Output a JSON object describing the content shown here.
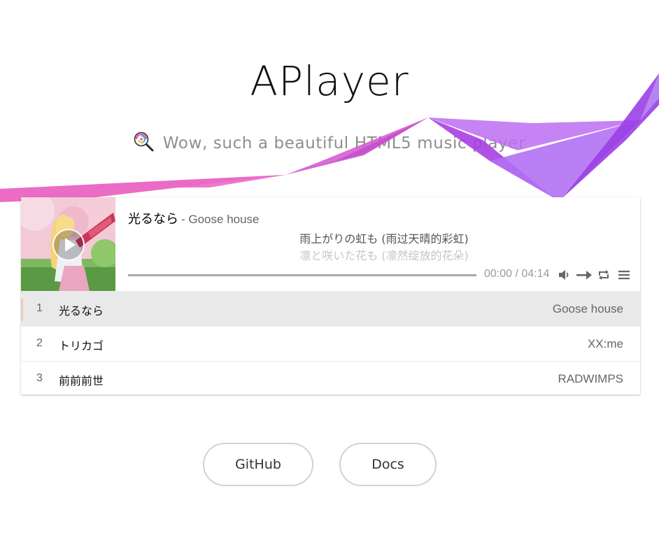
{
  "header": {
    "title": "APlayer",
    "subtitle": "Wow, such a beautiful HTML5 music player",
    "subtitle_icon": "lollipop-icon"
  },
  "player": {
    "now_playing": {
      "title": "光るなら",
      "author": "- Goose house"
    },
    "lyrics": {
      "current": "雨上がりの虹も (雨过天晴的彩虹)",
      "next": "凛と咲いた花も (凛然绽放的花朵)"
    },
    "time": "00:00 / 04:14",
    "progress_played": 0,
    "icons": {
      "cover_play": "play-icon",
      "volume": "volume-icon",
      "order": "order-arrow-icon",
      "loop": "loop-icon",
      "menu": "menu-icon"
    },
    "colors": {
      "theme": "#b7daff",
      "active_row": "#e9e9e9",
      "active_indicator": "#e6cfc0"
    }
  },
  "playlist": [
    {
      "index": "1",
      "title": "光るなら",
      "artist": "Goose house",
      "active": true
    },
    {
      "index": "2",
      "title": "トリカゴ",
      "artist": "XX:me",
      "active": false
    },
    {
      "index": "3",
      "title": "前前前世",
      "artist": "RADWIMPS",
      "active": false
    }
  ],
  "links": {
    "github": "GitHub",
    "docs": "Docs"
  },
  "decoration": {
    "ribbon_colors": [
      "#e657b8",
      "#d24fc9",
      "#c353d6",
      "#9d3ee0",
      "#b571f0"
    ]
  }
}
